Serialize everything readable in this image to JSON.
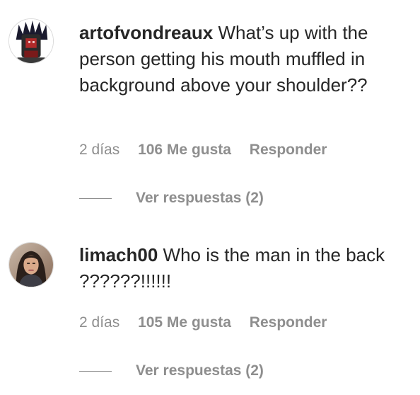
{
  "comments": [
    {
      "username": "artofvondreaux",
      "text": "What’s up with the person getting his mouth muffled in background above your shoulder??",
      "time": "2 días",
      "likes": "106 Me gusta",
      "reply_label": "Responder",
      "view_replies": "Ver respuestas (2)"
    },
    {
      "username": "limach00",
      "text": "Who is the man in the back ??????!!!!!!",
      "time": "2 días",
      "likes": "105 Me gusta",
      "reply_label": "Responder",
      "view_replies": "Ver respuestas (2)"
    }
  ]
}
